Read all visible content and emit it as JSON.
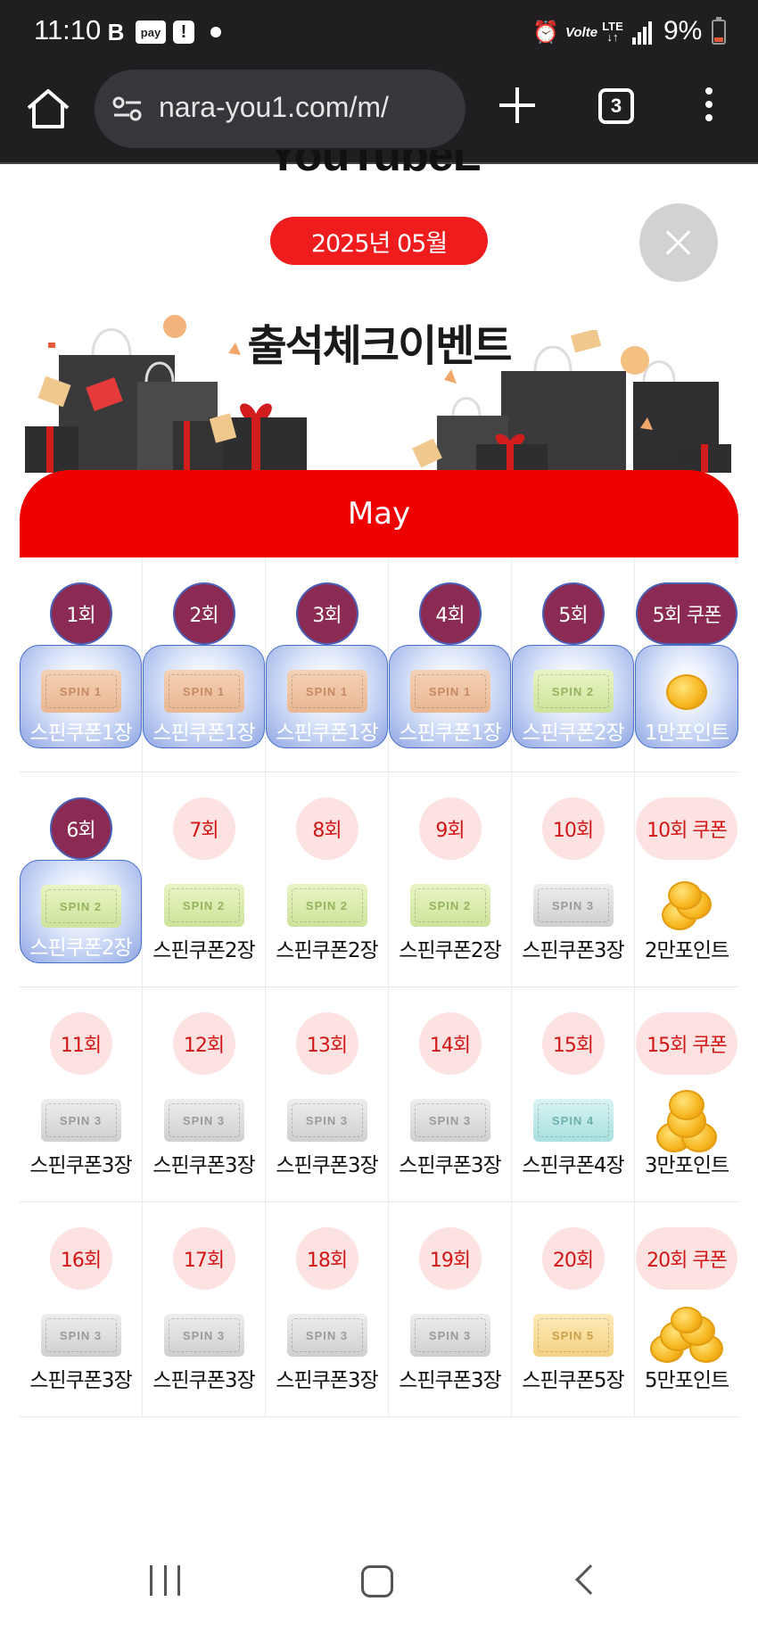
{
  "status_bar": {
    "time": "11:10",
    "battery_text": "9%",
    "icons": [
      "b-icon",
      "pay-icon",
      "alert-icon",
      "dot-icon",
      "alarm-icon",
      "volte-icon",
      "lte-icon",
      "signal-icon",
      "battery-icon"
    ],
    "b_glyph": "B",
    "pay_glyph": "pay",
    "alert_glyph": "!",
    "volte_glyph": "Volte",
    "lte_top": "LTE",
    "lte_bottom": "↓↑"
  },
  "browser": {
    "url": "nara-you1.com/m/",
    "tab_count": "3"
  },
  "page": {
    "site_title": "YouTubeL",
    "date_label": "2025년 05월",
    "event_title": "출석체크이벤트",
    "month_label": "May"
  },
  "calendar": {
    "rows": [
      [
        {
          "day": "1회",
          "reward": "스핀쿠폰1장",
          "ticket": "SPIN 1",
          "kind": "t1",
          "done": true
        },
        {
          "day": "2회",
          "reward": "스핀쿠폰1장",
          "ticket": "SPIN 1",
          "kind": "t1",
          "done": true
        },
        {
          "day": "3회",
          "reward": "스핀쿠폰1장",
          "ticket": "SPIN 1",
          "kind": "t1",
          "done": true
        },
        {
          "day": "4회",
          "reward": "스핀쿠폰1장",
          "ticket": "SPIN 1",
          "kind": "t1",
          "done": true
        },
        {
          "day": "5회",
          "reward": "스핀쿠폰2장",
          "ticket": "SPIN 2",
          "kind": "t2",
          "done": true
        },
        {
          "day": "5회 쿠폰",
          "reward": "1만포인트",
          "ticket": "",
          "kind": "coin1",
          "done": true
        }
      ],
      [
        {
          "day": "6회",
          "reward": "스핀쿠폰2장",
          "ticket": "SPIN 2",
          "kind": "t2",
          "done": true
        },
        {
          "day": "7회",
          "reward": "스핀쿠폰2장",
          "ticket": "SPIN 2",
          "kind": "t2",
          "done": false
        },
        {
          "day": "8회",
          "reward": "스핀쿠폰2장",
          "ticket": "SPIN 2",
          "kind": "t2",
          "done": false
        },
        {
          "day": "9회",
          "reward": "스핀쿠폰2장",
          "ticket": "SPIN 2",
          "kind": "t2",
          "done": false
        },
        {
          "day": "10회",
          "reward": "스핀쿠폰3장",
          "ticket": "SPIN 3",
          "kind": "t3",
          "done": false
        },
        {
          "day": "10회 쿠폰",
          "reward": "2만포인트",
          "ticket": "",
          "kind": "coin2",
          "done": false
        }
      ],
      [
        {
          "day": "11회",
          "reward": "스핀쿠폰3장",
          "ticket": "SPIN 3",
          "kind": "t3",
          "done": false
        },
        {
          "day": "12회",
          "reward": "스핀쿠폰3장",
          "ticket": "SPIN 3",
          "kind": "t3",
          "done": false
        },
        {
          "day": "13회",
          "reward": "스핀쿠폰3장",
          "ticket": "SPIN 3",
          "kind": "t3",
          "done": false
        },
        {
          "day": "14회",
          "reward": "스핀쿠폰3장",
          "ticket": "SPIN 3",
          "kind": "t3",
          "done": false
        },
        {
          "day": "15회",
          "reward": "스핀쿠폰4장",
          "ticket": "SPIN 4",
          "kind": "t4",
          "done": false
        },
        {
          "day": "15회 쿠폰",
          "reward": "3만포인트",
          "ticket": "",
          "kind": "coin3",
          "done": false
        }
      ],
      [
        {
          "day": "16회",
          "reward": "스핀쿠폰3장",
          "ticket": "SPIN 3",
          "kind": "t3",
          "done": false
        },
        {
          "day": "17회",
          "reward": "스핀쿠폰3장",
          "ticket": "SPIN 3",
          "kind": "t3",
          "done": false
        },
        {
          "day": "18회",
          "reward": "스핀쿠폰3장",
          "ticket": "SPIN 3",
          "kind": "t3",
          "done": false
        },
        {
          "day": "19회",
          "reward": "스핀쿠폰3장",
          "ticket": "SPIN 3",
          "kind": "t3",
          "done": false
        },
        {
          "day": "20회",
          "reward": "스핀쿠폰5장",
          "ticket": "SPIN 5",
          "kind": "t5",
          "done": false
        },
        {
          "day": "20회 쿠폰",
          "reward": "5만포인트",
          "ticket": "",
          "kind": "coin4",
          "done": false
        }
      ]
    ]
  },
  "colors": {
    "accent_red": "#ee0000",
    "completed_badge": "#8b2a52",
    "pending_badge": "#fde2e2",
    "browser_bg": "#1f1f21"
  }
}
